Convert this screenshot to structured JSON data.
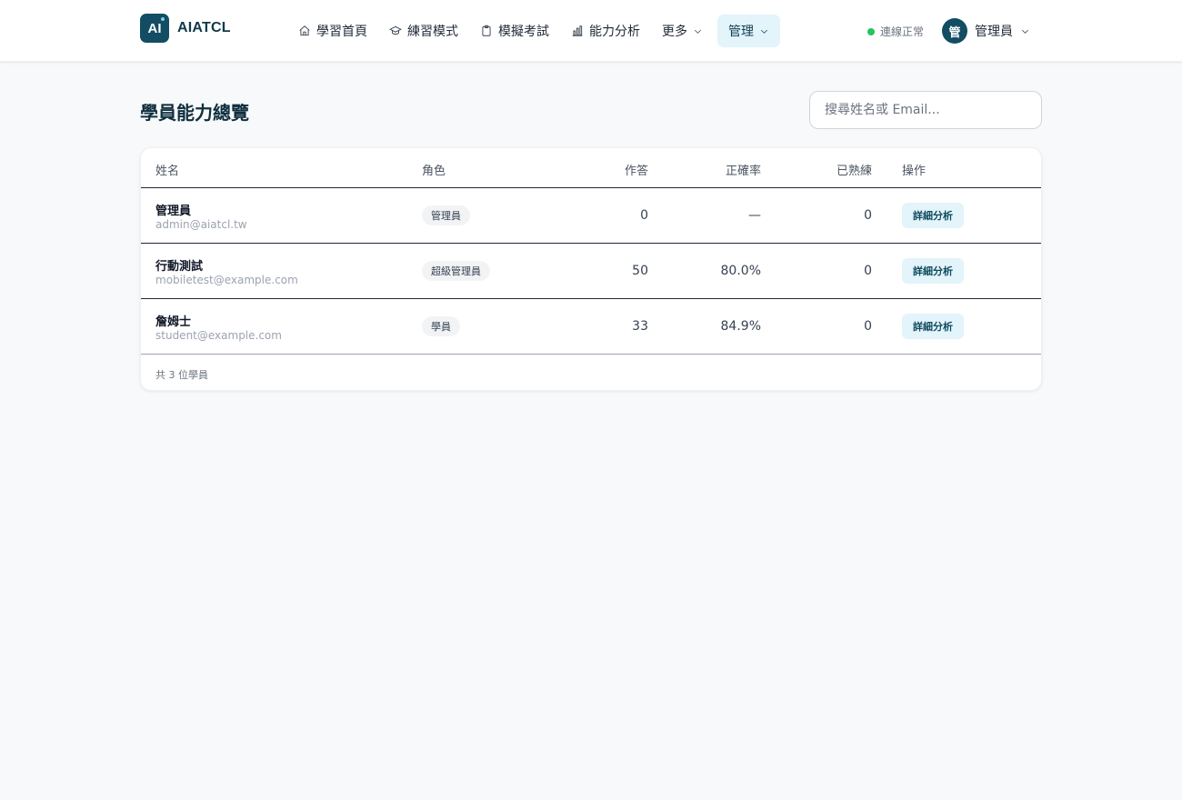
{
  "brand": {
    "logo_text": "AI",
    "name": "AIATCL"
  },
  "nav": {
    "items": [
      {
        "label": "學習首頁",
        "icon": "home-icon"
      },
      {
        "label": "練習模式",
        "icon": "graduation-cap-icon"
      },
      {
        "label": "模擬考試",
        "icon": "clipboard-icon"
      },
      {
        "label": "能力分析",
        "icon": "bar-chart-icon"
      },
      {
        "label": "更多",
        "icon": "chevron-down-icon"
      },
      {
        "label": "管理",
        "icon": "chevron-down-icon",
        "active": true
      }
    ]
  },
  "status": {
    "label": "連線正常",
    "color": "#22c55e"
  },
  "user": {
    "avatar": "管",
    "name": "管理員"
  },
  "page": {
    "title": "學員能力總覽",
    "search_placeholder": "搜尋姓名或 Email..."
  },
  "table": {
    "headers": {
      "name": "姓名",
      "role": "角色",
      "answered": "作答",
      "accuracy": "正確率",
      "mastered": "已熟練",
      "action": "操作"
    },
    "rows": [
      {
        "name": "管理員",
        "email": "admin@aiatcl.tw",
        "role": "管理員",
        "answered": "0",
        "accuracy": "—",
        "mastered": "0",
        "action": "詳細分析"
      },
      {
        "name": "行動測試",
        "email": "mobiletest@example.com",
        "role": "超級管理員",
        "answered": "50",
        "accuracy": "80.0%",
        "mastered": "0",
        "action": "詳細分析"
      },
      {
        "name": "詹姆士",
        "email": "student@example.com",
        "role": "學員",
        "answered": "33",
        "accuracy": "84.9%",
        "mastered": "0",
        "action": "詳細分析"
      }
    ],
    "footer": "共 3 位學員"
  },
  "colors": {
    "brand": "#124d63",
    "active_bg": "#e3f4fa",
    "page_bg": "#f7f9fb"
  }
}
